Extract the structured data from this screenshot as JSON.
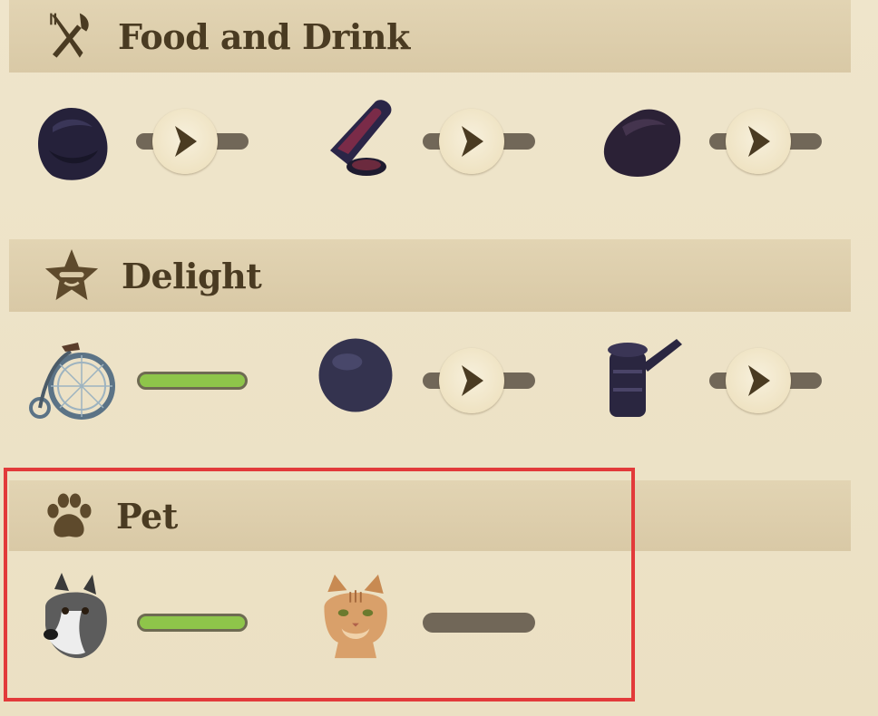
{
  "sections": {
    "food": {
      "title": "Food and Drink",
      "icon": "fork-knife-icon",
      "items": [
        {
          "name": "dark-food-bag",
          "status": "locked"
        },
        {
          "name": "bottle-and-bowl",
          "status": "locked"
        },
        {
          "name": "dark-chunk",
          "status": "locked"
        }
      ]
    },
    "delight": {
      "title": "Delight",
      "icon": "star-face-icon",
      "items": [
        {
          "name": "penny-farthing-bicycle",
          "status": "unlocked"
        },
        {
          "name": "dark-ball",
          "status": "locked"
        },
        {
          "name": "coffee-grinder",
          "status": "locked"
        }
      ]
    },
    "pet": {
      "title": "Pet",
      "icon": "paw-icon",
      "items": [
        {
          "name": "husky-dog",
          "status": "unlocked"
        },
        {
          "name": "tabby-cat",
          "status": "inactive"
        }
      ]
    }
  },
  "colors": {
    "background": "#ede2c6",
    "header": "#d9c9a6",
    "title_text": "#4a3b22",
    "bar_unlocked": "#8ec54a",
    "bar_locked": "#716758",
    "highlight": "#e23a3a"
  }
}
